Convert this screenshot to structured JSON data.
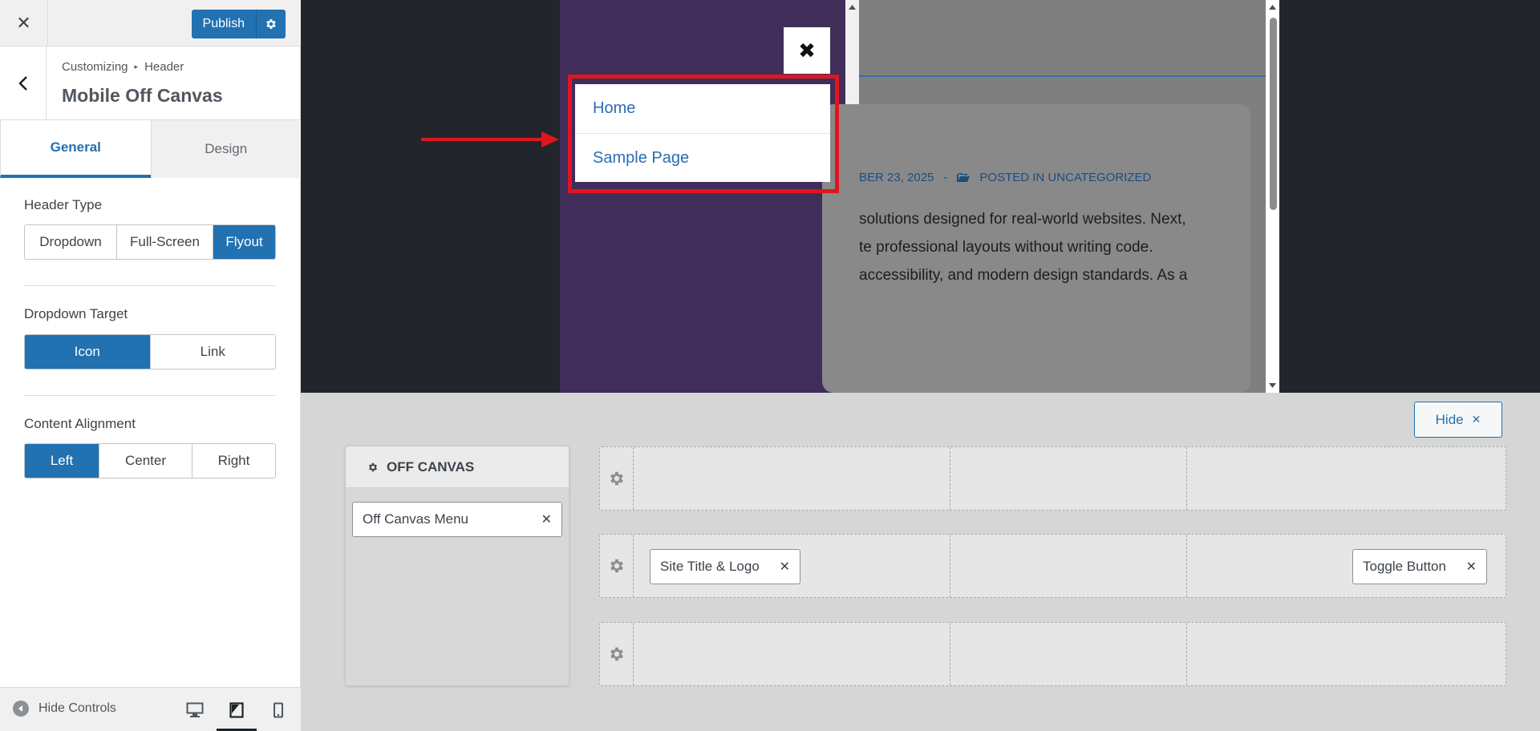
{
  "topbar": {
    "close_icon": "close-icon",
    "publish_label": "Publish"
  },
  "section": {
    "breadcrumb_parent": "Customizing",
    "breadcrumb_child": "Header",
    "title": "Mobile Off Canvas"
  },
  "tabs": [
    {
      "label": "General",
      "active": true
    },
    {
      "label": "Design",
      "active": false
    }
  ],
  "controls": {
    "header_type": {
      "label": "Header Type",
      "options": [
        "Dropdown",
        "Full-Screen",
        "Flyout"
      ],
      "selected": "Flyout"
    },
    "dropdown_target": {
      "label": "Dropdown Target",
      "options": [
        "Icon",
        "Link"
      ],
      "selected": "Icon"
    },
    "content_alignment": {
      "label": "Content Alignment",
      "options": [
        "Left",
        "Center",
        "Right"
      ],
      "selected": "Left"
    }
  },
  "footer": {
    "hide_controls_label": "Hide Controls",
    "devices": [
      "desktop",
      "tablet",
      "mobile"
    ],
    "active_device": "tablet"
  },
  "preview": {
    "menu_items": [
      "Home",
      "Sample Page"
    ],
    "close_glyph": "✖",
    "meta_date": "BER 23, 2025",
    "meta_sep": "-",
    "meta_posted": "POSTED IN UNCATEGORIZED",
    "excerpt_lines": [
      "solutions designed for real-world websites. Next,",
      "te professional layouts without writing code.",
      "accessibility, and modern design standards. As a"
    ]
  },
  "builder": {
    "hide_label": "Hide",
    "off_canvas_title": "OFF CANVAS",
    "off_canvas_items": [
      "Off Canvas Menu"
    ],
    "rows": [
      {
        "left": "",
        "center": "",
        "right": ""
      },
      {
        "left": "Site Title & Logo",
        "center": "",
        "right": "Toggle Button"
      },
      {
        "left": "",
        "center": "",
        "right": ""
      }
    ]
  },
  "colors": {
    "accent": "#2271b1",
    "offcanvas_bg": "#402d59",
    "annotation_red": "#e0151f",
    "menu_link": "#2b6eb2"
  }
}
